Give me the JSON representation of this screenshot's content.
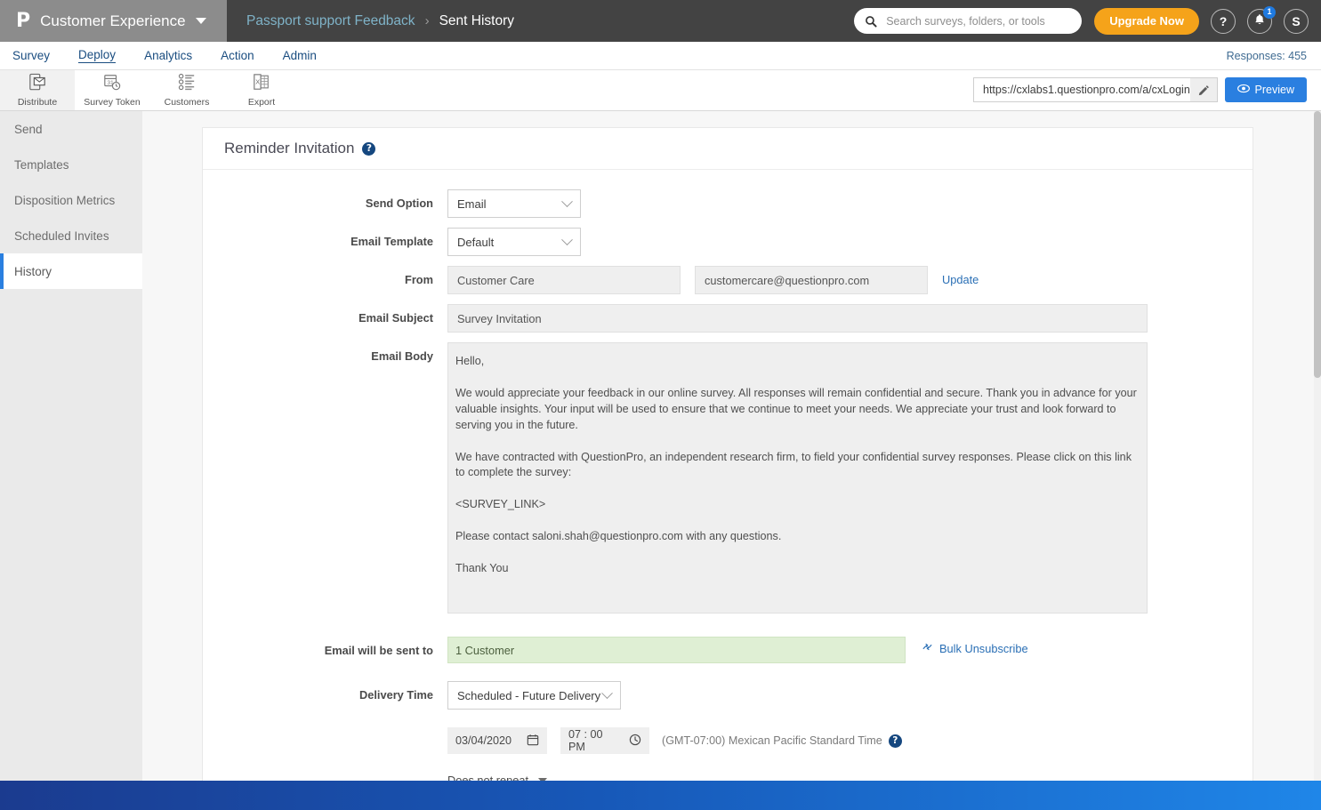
{
  "topbar": {
    "logo": "P",
    "brand": "Customer Experience",
    "breadcrumb_parent": "Passport support Feedback",
    "breadcrumb_sep": "›",
    "breadcrumb_current": "Sent History",
    "search_placeholder": "Search surveys, folders, or tools",
    "upgrade_label": "Upgrade Now",
    "help_label": "?",
    "notification_count": "1",
    "avatar_initial": "S",
    "brand_bg": "#8c8c8c",
    "bar_bg": "#434343",
    "upgrade_color": "#f5a31a"
  },
  "nav": {
    "items": [
      {
        "label": "Survey",
        "active": false
      },
      {
        "label": "Deploy",
        "active": true
      },
      {
        "label": "Analytics",
        "active": false
      },
      {
        "label": "Action",
        "active": false
      },
      {
        "label": "Admin",
        "active": false
      }
    ],
    "responses": "Responses: 455",
    "link_color": "#1a4d80"
  },
  "toolbar": {
    "tools": [
      {
        "label": "Distribute",
        "icon": "distribute-icon",
        "active": true
      },
      {
        "label": "Survey Token",
        "icon": "calendar-token-icon",
        "active": false
      },
      {
        "label": "Customers",
        "icon": "customers-list-icon",
        "active": false
      },
      {
        "label": "Export",
        "icon": "excel-export-icon",
        "active": false
      }
    ],
    "url": "https://cxlabs1.questionpro.com/a/cxLogin",
    "edit_icon": "pencil-icon",
    "preview_label": "Preview",
    "preview_icon": "eye-icon",
    "preview_color": "#2a7fe0"
  },
  "sidebar": {
    "items": [
      {
        "label": "Send",
        "active": false
      },
      {
        "label": "Templates",
        "active": false
      },
      {
        "label": "Disposition Metrics",
        "active": false
      },
      {
        "label": "Scheduled Invites",
        "active": false
      },
      {
        "label": "History",
        "active": true
      }
    ],
    "active_border_color": "#2a7fe0"
  },
  "card": {
    "title": "Reminder Invitation",
    "help_icon": "help-circle-icon"
  },
  "form": {
    "send_option": {
      "label": "Send Option",
      "value": "Email"
    },
    "email_template": {
      "label": "Email Template",
      "value": "Default"
    },
    "from": {
      "label": "From",
      "name": "Customer Care",
      "email": "customercare@questionpro.com",
      "update_label": "Update"
    },
    "email_subject": {
      "label": "Email Subject",
      "value": "Survey Invitation"
    },
    "email_body": {
      "label": "Email Body",
      "paragraphs": [
        "Hello,",
        "We would appreciate your feedback in our online survey. All responses will remain confidential and secure. Thank you in advance for your valuable insights. Your input will be used to ensure that we continue to meet your needs. We appreciate your trust and look forward to serving you in the future.",
        "We have contracted with QuestionPro, an independent research firm, to field your confidential survey responses. Please click on this link to complete the survey:",
        "<SURVEY_LINK>",
        "Please contact saloni.shah@questionpro.com with any questions.",
        "Thank You"
      ]
    },
    "recipients": {
      "label": "Email will be sent to",
      "value": "1 Customer",
      "bulk_unsubscribe": "Bulk Unsubscribe",
      "bulk_icon": "unsubscribe-icon",
      "green_bg": "#dfefd4"
    },
    "delivery_time": {
      "label": "Delivery Time",
      "value": "Scheduled - Future Delivery",
      "date": "03/04/2020",
      "date_icon": "calendar-icon",
      "time": "07 : 00 PM",
      "time_icon": "clock-icon",
      "timezone": "(GMT-07:00) Mexican Pacific Standard Time",
      "timezone_help_icon": "help-circle-icon",
      "repeat": "Does not repeat"
    }
  }
}
